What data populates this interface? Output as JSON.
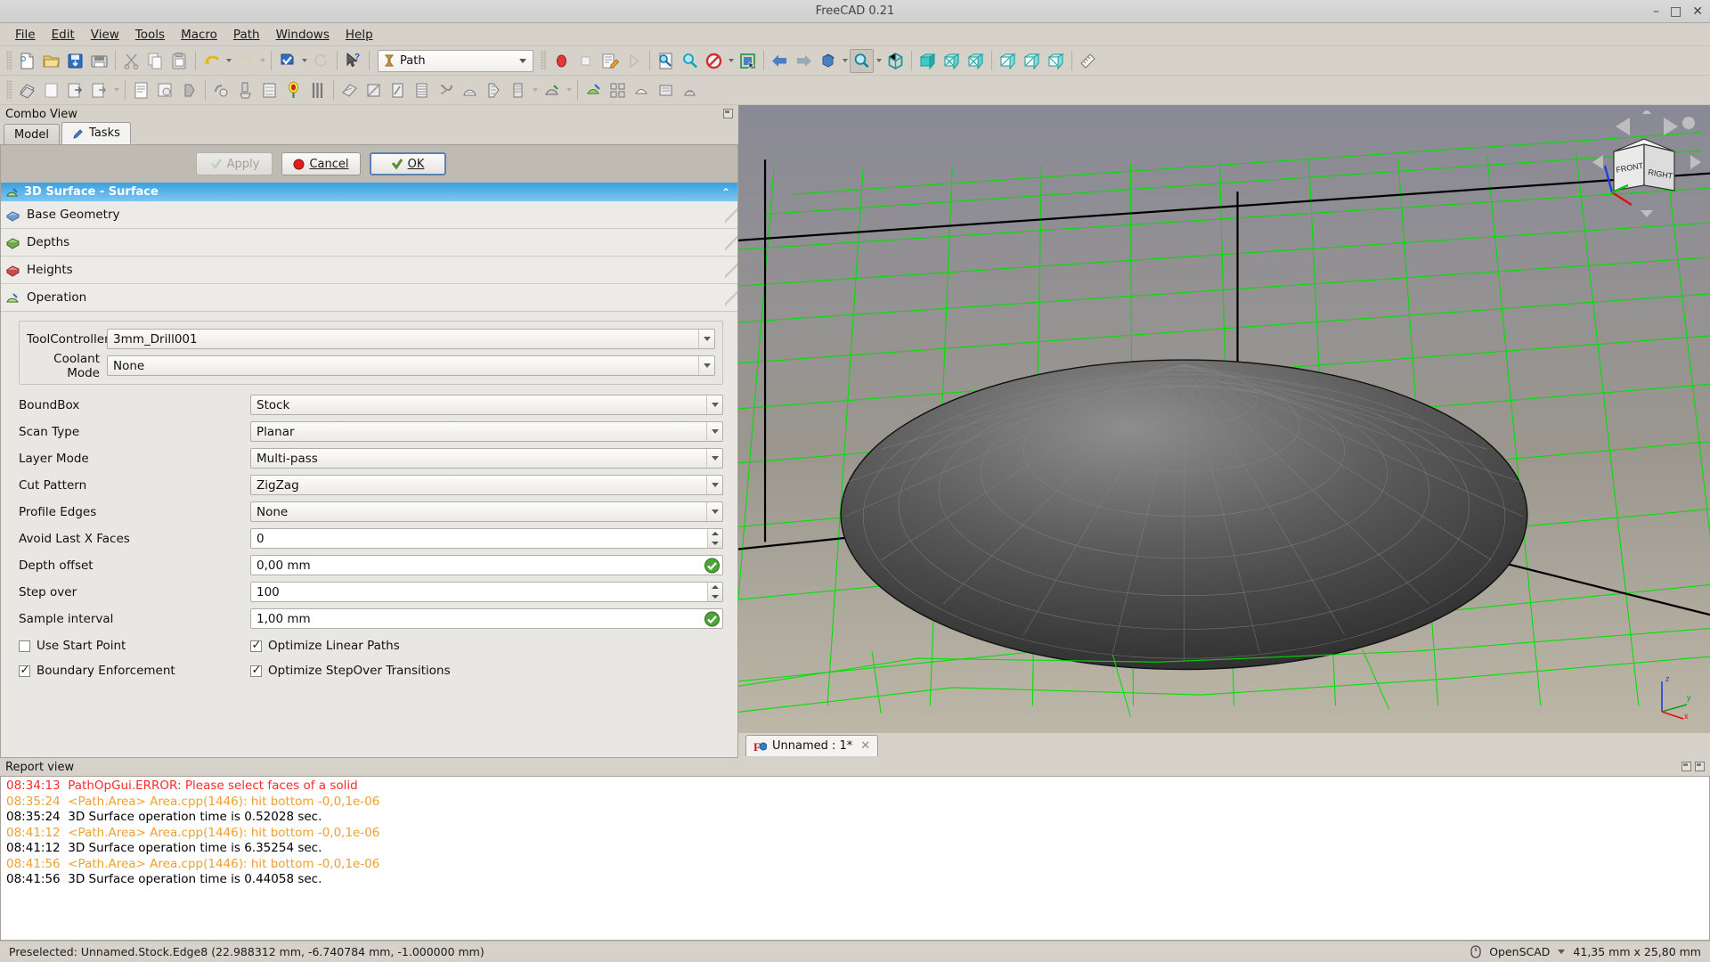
{
  "window": {
    "title": "FreeCAD 0.21",
    "minimize": "–",
    "maximize": "□",
    "close": "✕"
  },
  "menu": [
    {
      "label": "File",
      "mnemonic": "F"
    },
    {
      "label": "Edit",
      "mnemonic": "E"
    },
    {
      "label": "View",
      "mnemonic": "V"
    },
    {
      "label": "Tools",
      "mnemonic": "T"
    },
    {
      "label": "Macro",
      "mnemonic": "M"
    },
    {
      "label": "Path",
      "mnemonic": "P"
    },
    {
      "label": "Windows",
      "mnemonic": "W"
    },
    {
      "label": "Help",
      "mnemonic": "H"
    }
  ],
  "workbench": {
    "selected": "Path"
  },
  "combo_view": {
    "dock_title": "Combo View",
    "tabs": [
      {
        "label": "Model",
        "selected": false
      },
      {
        "label": "Tasks",
        "selected": true
      }
    ]
  },
  "dialog_buttons": {
    "apply": "Apply",
    "cancel": "Cancel",
    "ok": "OK"
  },
  "task": {
    "header": "3D Surface - Surface",
    "groups": [
      {
        "label": "Base Geometry",
        "icon": "base-geometry-icon"
      },
      {
        "label": "Depths",
        "icon": "depths-icon"
      },
      {
        "label": "Heights",
        "icon": "heights-icon"
      },
      {
        "label": "Operation",
        "icon": "operation-icon"
      }
    ],
    "tool_fields": [
      {
        "label": "ToolController",
        "value": "3mm_Drill001",
        "type": "combo"
      },
      {
        "label": "Coolant Mode",
        "value": "None",
        "type": "combo"
      }
    ],
    "fields": [
      {
        "label": "BoundBox",
        "value": "Stock",
        "type": "combo"
      },
      {
        "label": "Scan Type",
        "value": "Planar",
        "type": "combo"
      },
      {
        "label": "Layer Mode",
        "value": "Multi-pass",
        "type": "combo"
      },
      {
        "label": "Cut Pattern",
        "value": "ZigZag",
        "type": "combo"
      },
      {
        "label": "Profile Edges",
        "value": "None",
        "type": "combo"
      },
      {
        "label": "Avoid Last X Faces",
        "value": "0",
        "type": "spin"
      },
      {
        "label": "Depth offset",
        "value": "0,00 mm",
        "type": "validated"
      },
      {
        "label": "Step over",
        "value": "100",
        "type": "spin"
      },
      {
        "label": "Sample interval",
        "value": "1,00 mm",
        "type": "validated"
      }
    ],
    "checkboxes": [
      {
        "label": "Use Start Point",
        "checked": false
      },
      {
        "label": "Optimize Linear Paths",
        "checked": true
      },
      {
        "label": "Boundary Enforcement",
        "checked": true
      },
      {
        "label": "Optimize StepOver Transitions",
        "checked": true
      }
    ]
  },
  "document_tab": {
    "label": "Unnamed : 1*",
    "close": "✕"
  },
  "navigation_cube": {
    "front": "FRONT",
    "right": "RIGHT"
  },
  "axis_indicator": {
    "x": "x",
    "y": "y",
    "z": "z"
  },
  "report_view": {
    "title": "Report view",
    "lines": [
      {
        "time": "08:34:13",
        "text": "PathOpGui.ERROR: Please select faces of a solid",
        "color": "#ff2a2a"
      },
      {
        "time": "08:35:24",
        "text": "<Path.Area> Area.cpp(1446): hit bottom -0,0,1e-06",
        "color": "#f0a030"
      },
      {
        "time": "08:35:24",
        "text": "3D Surface operation time is 0.52028 sec.",
        "color": "#000000"
      },
      {
        "time": "08:41:12",
        "text": "<Path.Area> Area.cpp(1446): hit bottom -0,0,1e-06",
        "color": "#f0a030"
      },
      {
        "time": "08:41:12",
        "text": "3D Surface operation time is 6.35254 sec.",
        "color": "#000000"
      },
      {
        "time": "08:41:56",
        "text": "<Path.Area> Area.cpp(1446): hit bottom -0,0,1e-06",
        "color": "#f0a030"
      },
      {
        "time": "08:41:56",
        "text": "3D Surface operation time is 0.44058 sec.",
        "color": "#000000"
      }
    ]
  },
  "status_bar": {
    "message": "Preselected: Unnamed.Stock.Edge8 (22.988312 mm, -6.740784 mm, -1.000000 mm)",
    "unit_system": "OpenSCAD",
    "dimensions": "41,35 mm x 25,80 mm"
  },
  "colors": {
    "accent": "#3aa0e0",
    "error": "#ff2a2a",
    "warning": "#f0a030",
    "wireframe_green": "#00e000",
    "viewport_bg_top": "#84848f",
    "viewport_bg_bottom": "#b5b0a4"
  }
}
